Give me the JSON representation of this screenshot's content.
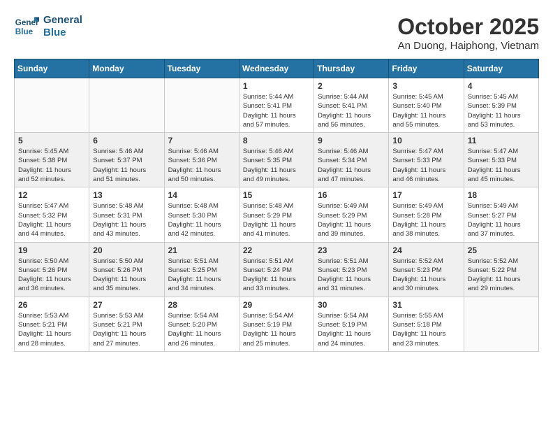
{
  "header": {
    "logo_general": "General",
    "logo_blue": "Blue",
    "title": "October 2025",
    "subtitle": "An Duong, Haiphong, Vietnam"
  },
  "weekdays": [
    "Sunday",
    "Monday",
    "Tuesday",
    "Wednesday",
    "Thursday",
    "Friday",
    "Saturday"
  ],
  "weeks": [
    [
      {
        "day": "",
        "info": ""
      },
      {
        "day": "",
        "info": ""
      },
      {
        "day": "",
        "info": ""
      },
      {
        "day": "1",
        "info": "Sunrise: 5:44 AM\nSunset: 5:41 PM\nDaylight: 11 hours\nand 57 minutes."
      },
      {
        "day": "2",
        "info": "Sunrise: 5:44 AM\nSunset: 5:41 PM\nDaylight: 11 hours\nand 56 minutes."
      },
      {
        "day": "3",
        "info": "Sunrise: 5:45 AM\nSunset: 5:40 PM\nDaylight: 11 hours\nand 55 minutes."
      },
      {
        "day": "4",
        "info": "Sunrise: 5:45 AM\nSunset: 5:39 PM\nDaylight: 11 hours\nand 53 minutes."
      }
    ],
    [
      {
        "day": "5",
        "info": "Sunrise: 5:45 AM\nSunset: 5:38 PM\nDaylight: 11 hours\nand 52 minutes."
      },
      {
        "day": "6",
        "info": "Sunrise: 5:46 AM\nSunset: 5:37 PM\nDaylight: 11 hours\nand 51 minutes."
      },
      {
        "day": "7",
        "info": "Sunrise: 5:46 AM\nSunset: 5:36 PM\nDaylight: 11 hours\nand 50 minutes."
      },
      {
        "day": "8",
        "info": "Sunrise: 5:46 AM\nSunset: 5:35 PM\nDaylight: 11 hours\nand 49 minutes."
      },
      {
        "day": "9",
        "info": "Sunrise: 5:46 AM\nSunset: 5:34 PM\nDaylight: 11 hours\nand 47 minutes."
      },
      {
        "day": "10",
        "info": "Sunrise: 5:47 AM\nSunset: 5:33 PM\nDaylight: 11 hours\nand 46 minutes."
      },
      {
        "day": "11",
        "info": "Sunrise: 5:47 AM\nSunset: 5:33 PM\nDaylight: 11 hours\nand 45 minutes."
      }
    ],
    [
      {
        "day": "12",
        "info": "Sunrise: 5:47 AM\nSunset: 5:32 PM\nDaylight: 11 hours\nand 44 minutes."
      },
      {
        "day": "13",
        "info": "Sunrise: 5:48 AM\nSunset: 5:31 PM\nDaylight: 11 hours\nand 43 minutes."
      },
      {
        "day": "14",
        "info": "Sunrise: 5:48 AM\nSunset: 5:30 PM\nDaylight: 11 hours\nand 42 minutes."
      },
      {
        "day": "15",
        "info": "Sunrise: 5:48 AM\nSunset: 5:29 PM\nDaylight: 11 hours\nand 41 minutes."
      },
      {
        "day": "16",
        "info": "Sunrise: 5:49 AM\nSunset: 5:29 PM\nDaylight: 11 hours\nand 39 minutes."
      },
      {
        "day": "17",
        "info": "Sunrise: 5:49 AM\nSunset: 5:28 PM\nDaylight: 11 hours\nand 38 minutes."
      },
      {
        "day": "18",
        "info": "Sunrise: 5:49 AM\nSunset: 5:27 PM\nDaylight: 11 hours\nand 37 minutes."
      }
    ],
    [
      {
        "day": "19",
        "info": "Sunrise: 5:50 AM\nSunset: 5:26 PM\nDaylight: 11 hours\nand 36 minutes."
      },
      {
        "day": "20",
        "info": "Sunrise: 5:50 AM\nSunset: 5:26 PM\nDaylight: 11 hours\nand 35 minutes."
      },
      {
        "day": "21",
        "info": "Sunrise: 5:51 AM\nSunset: 5:25 PM\nDaylight: 11 hours\nand 34 minutes."
      },
      {
        "day": "22",
        "info": "Sunrise: 5:51 AM\nSunset: 5:24 PM\nDaylight: 11 hours\nand 33 minutes."
      },
      {
        "day": "23",
        "info": "Sunrise: 5:51 AM\nSunset: 5:23 PM\nDaylight: 11 hours\nand 31 minutes."
      },
      {
        "day": "24",
        "info": "Sunrise: 5:52 AM\nSunset: 5:23 PM\nDaylight: 11 hours\nand 30 minutes."
      },
      {
        "day": "25",
        "info": "Sunrise: 5:52 AM\nSunset: 5:22 PM\nDaylight: 11 hours\nand 29 minutes."
      }
    ],
    [
      {
        "day": "26",
        "info": "Sunrise: 5:53 AM\nSunset: 5:21 PM\nDaylight: 11 hours\nand 28 minutes."
      },
      {
        "day": "27",
        "info": "Sunrise: 5:53 AM\nSunset: 5:21 PM\nDaylight: 11 hours\nand 27 minutes."
      },
      {
        "day": "28",
        "info": "Sunrise: 5:54 AM\nSunset: 5:20 PM\nDaylight: 11 hours\nand 26 minutes."
      },
      {
        "day": "29",
        "info": "Sunrise: 5:54 AM\nSunset: 5:19 PM\nDaylight: 11 hours\nand 25 minutes."
      },
      {
        "day": "30",
        "info": "Sunrise: 5:54 AM\nSunset: 5:19 PM\nDaylight: 11 hours\nand 24 minutes."
      },
      {
        "day": "31",
        "info": "Sunrise: 5:55 AM\nSunset: 5:18 PM\nDaylight: 11 hours\nand 23 minutes."
      },
      {
        "day": "",
        "info": ""
      }
    ]
  ]
}
